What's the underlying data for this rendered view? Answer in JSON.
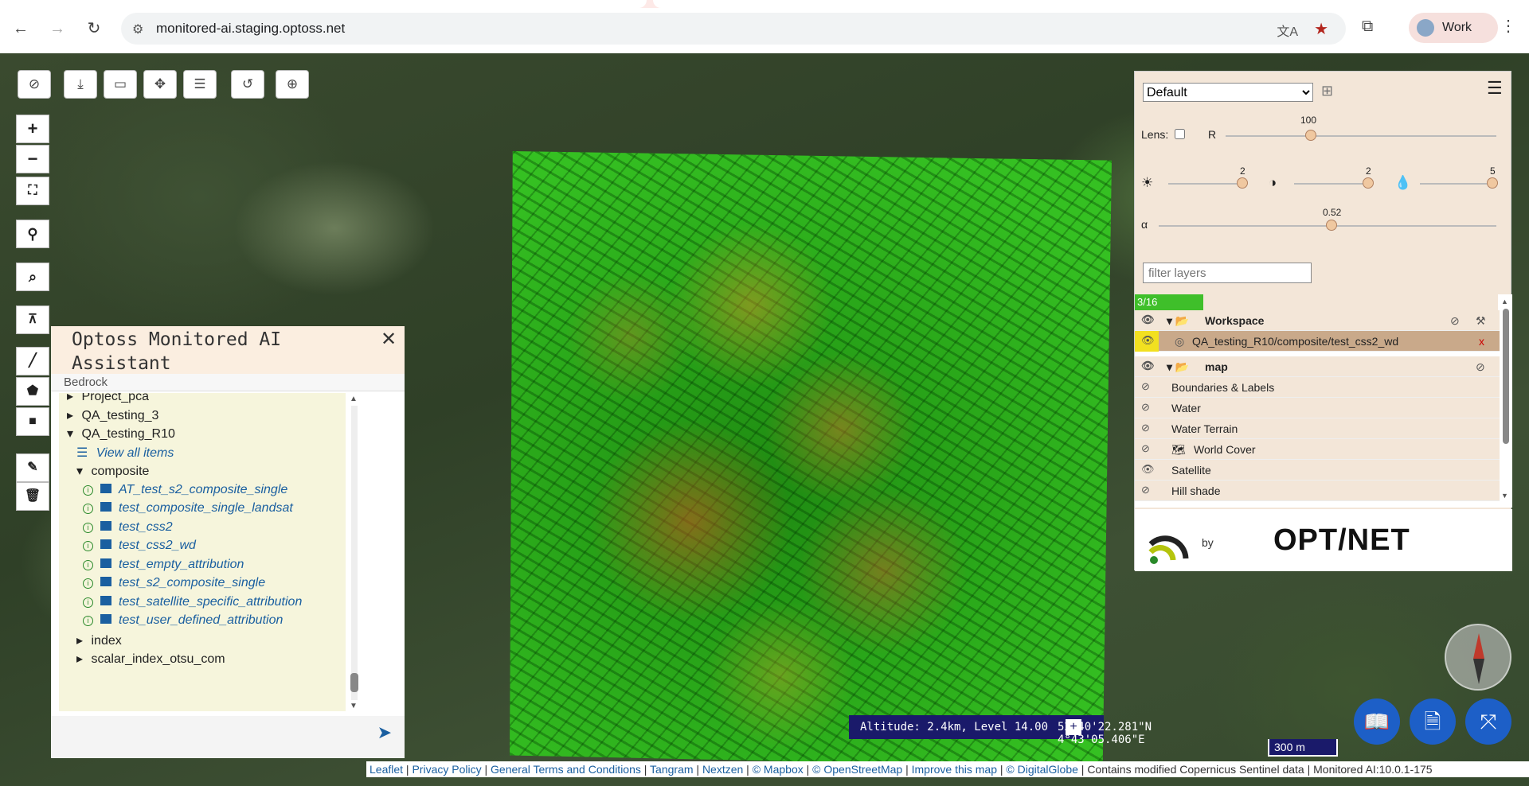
{
  "browser": {
    "url": "monitored-ai.staging.optoss.net",
    "profile_label": "Work"
  },
  "assistant": {
    "title": "Optoss Monitored AI Assistant",
    "subtitle": "Bedrock",
    "tree": [
      {
        "label": "Project_pca",
        "kind": "collapsed"
      },
      {
        "label": "QA_testing_3",
        "kind": "collapsed"
      },
      {
        "label": "QA_testing_R10",
        "kind": "expanded"
      },
      {
        "label": "View all items",
        "kind": "view"
      },
      {
        "label": "composite",
        "kind": "expanded"
      },
      {
        "label": "AT_test_s2_composite_single",
        "kind": "item"
      },
      {
        "label": "test_composite_single_landsat",
        "kind": "item"
      },
      {
        "label": "test_css2",
        "kind": "item"
      },
      {
        "label": "test_css2_wd",
        "kind": "item"
      },
      {
        "label": "test_empty_attribution",
        "kind": "item"
      },
      {
        "label": "test_s2_composite_single",
        "kind": "item"
      },
      {
        "label": "test_satellite_specific_attribution",
        "kind": "item"
      },
      {
        "label": "test_user_defined_attribution",
        "kind": "item"
      },
      {
        "label": "index",
        "kind": "collapsed"
      },
      {
        "label": "scalar_index_otsu_com",
        "kind": "collapsed"
      }
    ]
  },
  "panel": {
    "preset": "Default",
    "lens_label": "Lens:",
    "r_label": "R",
    "r_value": "100",
    "brightness_value": "2",
    "contrast_value": "2",
    "saturation_value": "5",
    "alpha_label": "α",
    "alpha_value": "0.52",
    "filter_placeholder": "filter layers",
    "count": "3/16",
    "workspace_label": "Workspace",
    "active_layer": "QA_testing_R10/composite/test_css2_wd",
    "remove_label": "x",
    "map_label": "map",
    "layers": [
      "Boundaries & Labels",
      "Water",
      "Water Terrain",
      "World Cover",
      "Satellite",
      "Hill shade"
    ],
    "by_label": "by",
    "brand": "OPT/NET"
  },
  "status": {
    "altitude": "Altitude: 2.4km, Level 14.00",
    "coords": "52°40'22.281\"N   4°43'05.406\"E",
    "scale": "300 m"
  },
  "attribution": {
    "leaflet": "Leaflet",
    "privacy": "Privacy Policy",
    "terms": "General Terms and Conditions",
    "tangram": "Tangram",
    "nextzen": "Nextzen",
    "mapbox": "© Mapbox",
    "osm": "© OpenStreetMap",
    "improve": "Improve this map",
    "digitalglobe": "© DigitalGlobe",
    "sentinel": "Contains modified Copernicus Sentinel data",
    "version": "Monitored AI:10.0.1-175"
  }
}
